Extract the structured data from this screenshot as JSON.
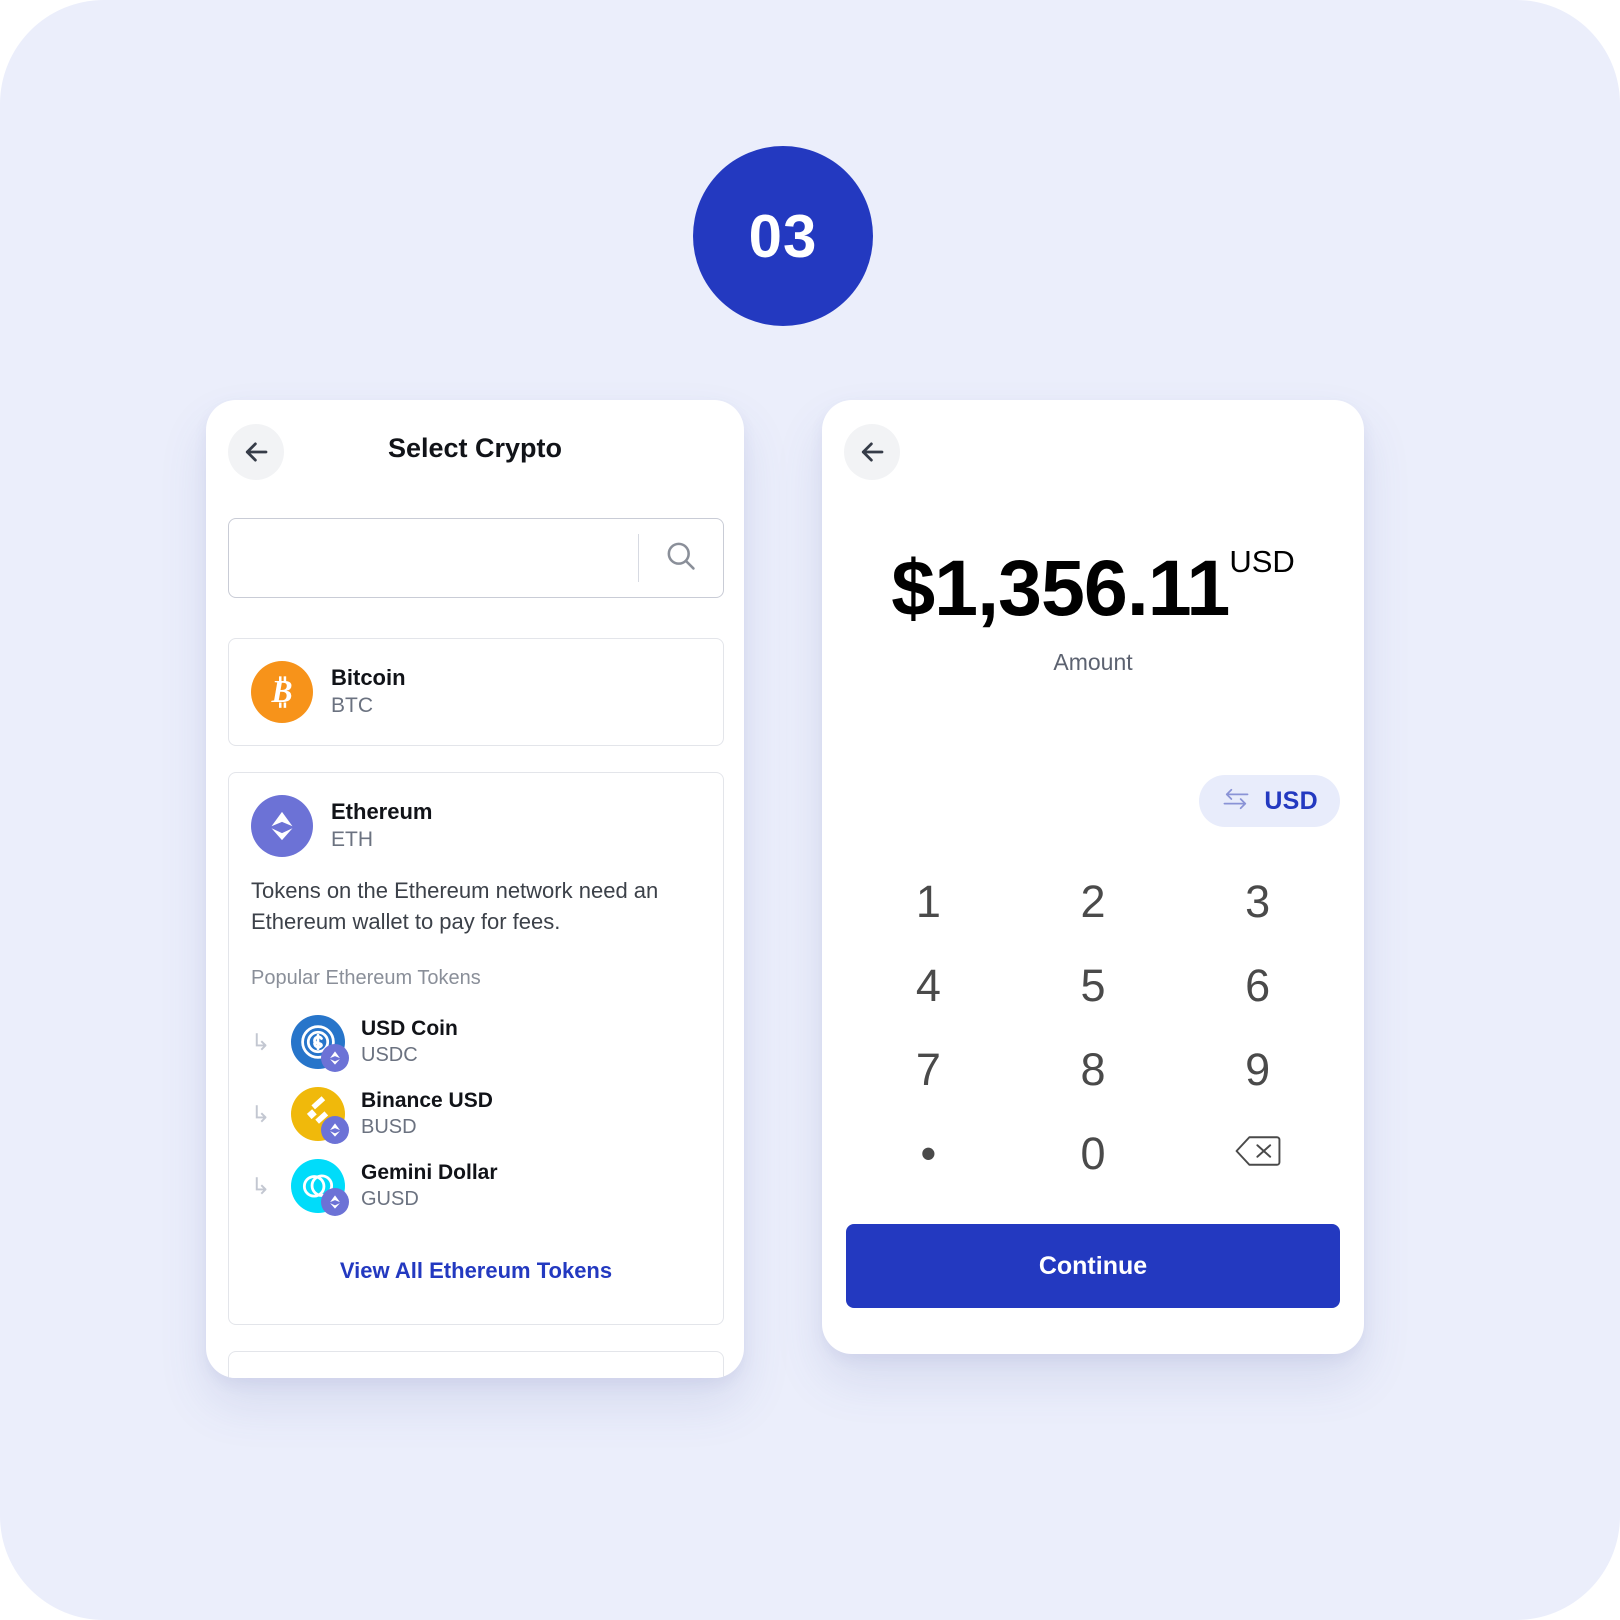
{
  "canvas": {
    "background": "#ebeefb"
  },
  "step_badge": {
    "label": "03",
    "color": "#2339c0"
  },
  "left_panel": {
    "title": "Select Crypto",
    "back_icon": "arrow-left-icon",
    "search": {
      "value": "",
      "placeholder": "",
      "icon": "search-icon"
    },
    "bitcoin": {
      "name": "Bitcoin",
      "symbol": "BTC",
      "icon": "bitcoin-icon",
      "color": "#f7931a",
      "glyph": "₿"
    },
    "ethereum": {
      "name": "Ethereum",
      "symbol": "ETH",
      "icon": "ethereum-icon",
      "color": "#6c72d6",
      "description": "Tokens on the Ethereum network need an Ethereum wallet to pay for fees.",
      "tokens_heading": "Popular Ethereum Tokens",
      "view_all_label": "View All Ethereum Tokens",
      "view_all_color": "#2339c0",
      "tokens": [
        {
          "name": "USD Coin",
          "symbol": "USDC",
          "icon": "usd-coin-icon",
          "color": "#2775ca",
          "badge": "ethereum-badge-icon"
        },
        {
          "name": "Binance USD",
          "symbol": "BUSD",
          "icon": "binance-usd-icon",
          "color": "#f0b90b",
          "badge": "ethereum-badge-icon"
        },
        {
          "name": "Gemini Dollar",
          "symbol": "GUSD",
          "icon": "gemini-dollar-icon",
          "color": "#00dcfa",
          "badge": "ethereum-badge-icon"
        }
      ]
    }
  },
  "right_panel": {
    "back_icon": "arrow-left-icon",
    "amount": {
      "value": "$1,356.11",
      "currency": "USD",
      "label": "Amount"
    },
    "swap_chip": {
      "label": "USD",
      "icon": "swap-arrows-icon",
      "color": "#2339c0",
      "background": "#e8ecfb"
    },
    "keypad": [
      {
        "key": "1",
        "type": "digit"
      },
      {
        "key": "2",
        "type": "digit"
      },
      {
        "key": "3",
        "type": "digit"
      },
      {
        "key": "4",
        "type": "digit"
      },
      {
        "key": "5",
        "type": "digit"
      },
      {
        "key": "6",
        "type": "digit"
      },
      {
        "key": "7",
        "type": "digit"
      },
      {
        "key": "8",
        "type": "digit"
      },
      {
        "key": "9",
        "type": "digit"
      },
      {
        "key": "•",
        "type": "decimal"
      },
      {
        "key": "0",
        "type": "digit"
      },
      {
        "key": "",
        "type": "backspace",
        "icon": "backspace-icon"
      }
    ],
    "continue_label": "Continue",
    "continue_color": "#2339c0"
  }
}
